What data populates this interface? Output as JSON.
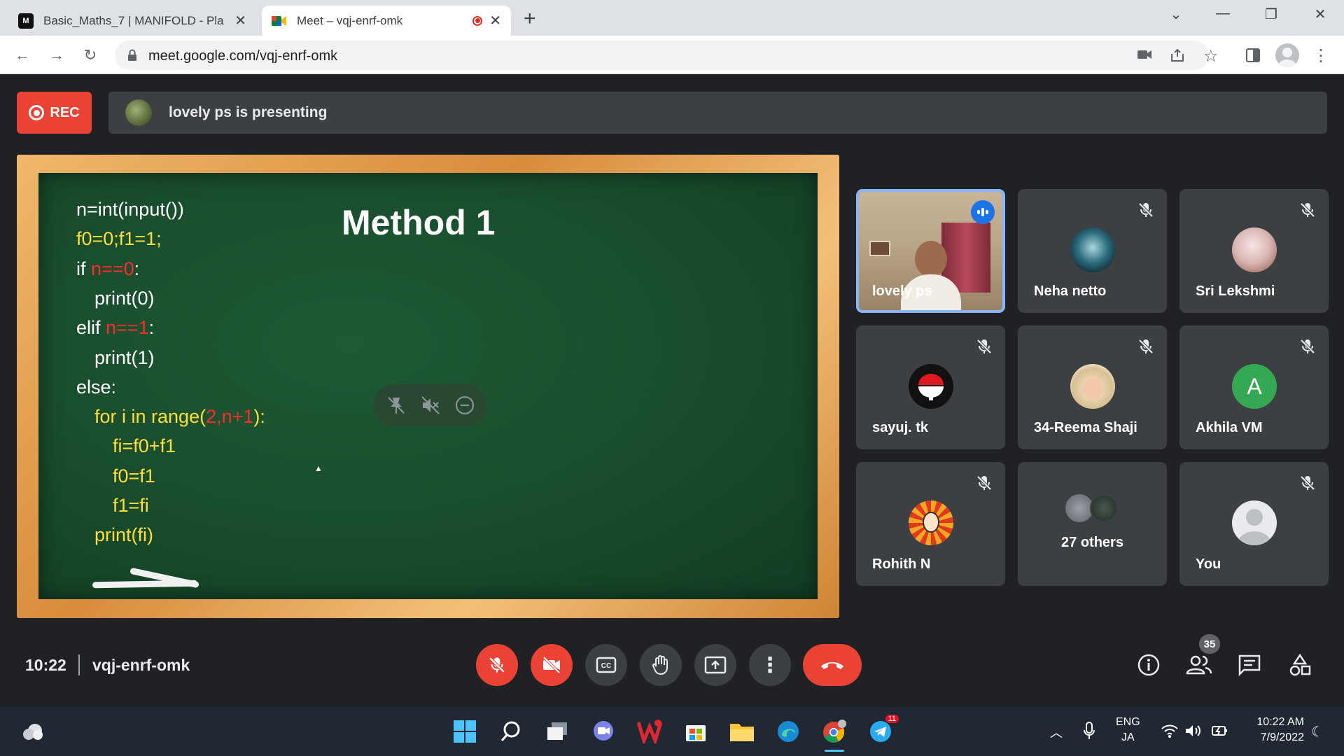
{
  "browser": {
    "tabs": [
      {
        "title": "Basic_Maths_7 | MANIFOLD - Pla",
        "favicon": "manifold-logo"
      },
      {
        "title": "Meet – vqj-enrf-omk",
        "favicon": "meet-logo",
        "recording": true
      }
    ],
    "url": "meet.google.com/vqj-enrf-omk"
  },
  "meet": {
    "rec_label": "REC",
    "presenting_text": "lovely ps is presenting",
    "time": "10:22",
    "meeting_code": "vqj-enrf-omk",
    "people_count": "35"
  },
  "board": {
    "title": "Method 1",
    "lines": [
      [
        {
          "t": "n=int(input())",
          "c": "w"
        }
      ],
      [
        {
          "t": "f0=0;f1=1;",
          "c": "y"
        }
      ],
      [
        {
          "t": "if ",
          "c": "w"
        },
        {
          "t": "n==0",
          "c": "r"
        },
        {
          "t": ":",
          "c": "w"
        }
      ],
      [
        {
          "t": "print(0)",
          "c": "w"
        }
      ],
      [
        {
          "t": "elif ",
          "c": "w"
        },
        {
          "t": "n==1",
          "c": "r"
        },
        {
          "t": ":",
          "c": "w"
        }
      ],
      [
        {
          "t": "print(1)",
          "c": "w"
        }
      ],
      [
        {
          "t": "else:",
          "c": "w"
        }
      ],
      [
        {
          "t": "for i in range(",
          "c": "y"
        },
        {
          "t": "2,n+1",
          "c": "r"
        },
        {
          "t": "):",
          "c": "y"
        }
      ],
      [
        {
          "t": "fi=f0+f1",
          "c": "y"
        }
      ],
      [
        {
          "t": "f0=f1",
          "c": "y"
        }
      ],
      [
        {
          "t": "f1=fi",
          "c": "y"
        }
      ],
      [
        {
          "t": "print(fi)",
          "c": "y"
        }
      ]
    ]
  },
  "participants": [
    {
      "name": "lovely ps",
      "speaking": true
    },
    {
      "name": "Neha netto",
      "muted": true
    },
    {
      "name": "Sri Lekshmi",
      "muted": true
    },
    {
      "name": "sayuj. tk",
      "muted": true
    },
    {
      "name": "34-Reema Shaji",
      "muted": true
    },
    {
      "name": "Akhila VM",
      "muted": true,
      "initial": "A",
      "avatar_color": "#34a853"
    },
    {
      "name": "Rohith N",
      "muted": true
    },
    {
      "name": "27 others"
    },
    {
      "name": "You",
      "muted": true
    }
  ],
  "taskbar": {
    "lang_line1": "ENG",
    "lang_line2": "JA",
    "time": "10:22 AM",
    "date": "7/9/2022",
    "telegram_badge": "11"
  }
}
